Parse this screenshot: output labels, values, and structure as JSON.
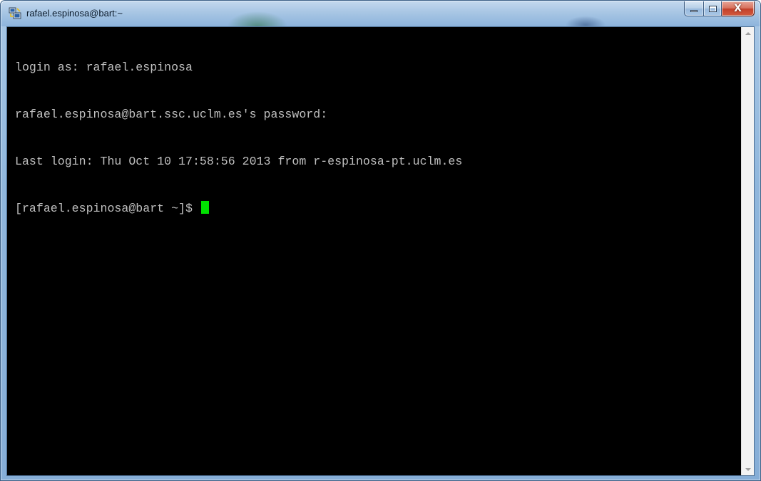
{
  "window": {
    "title": "rafael.espinosa@bart:~",
    "app_icon": "putty-icon"
  },
  "caption_buttons": {
    "minimize_icon": "minimize-icon",
    "maximize_icon": "maximize-icon",
    "close_glyph": "X"
  },
  "terminal": {
    "lines": [
      "login as: rafael.espinosa",
      "rafael.espinosa@bart.ssc.uclm.es's password:",
      "Last login: Thu Oct 10 17:58:56 2013 from r-espinosa-pt.uclm.es",
      "[rafael.espinosa@bart ~]$ "
    ],
    "background": "#000000",
    "text_color": "#bfbfbf",
    "cursor_color": "#00e000"
  },
  "scrollbar": {
    "up_icon": "scroll-up-arrow-icon",
    "down_icon": "scroll-down-arrow-icon"
  }
}
